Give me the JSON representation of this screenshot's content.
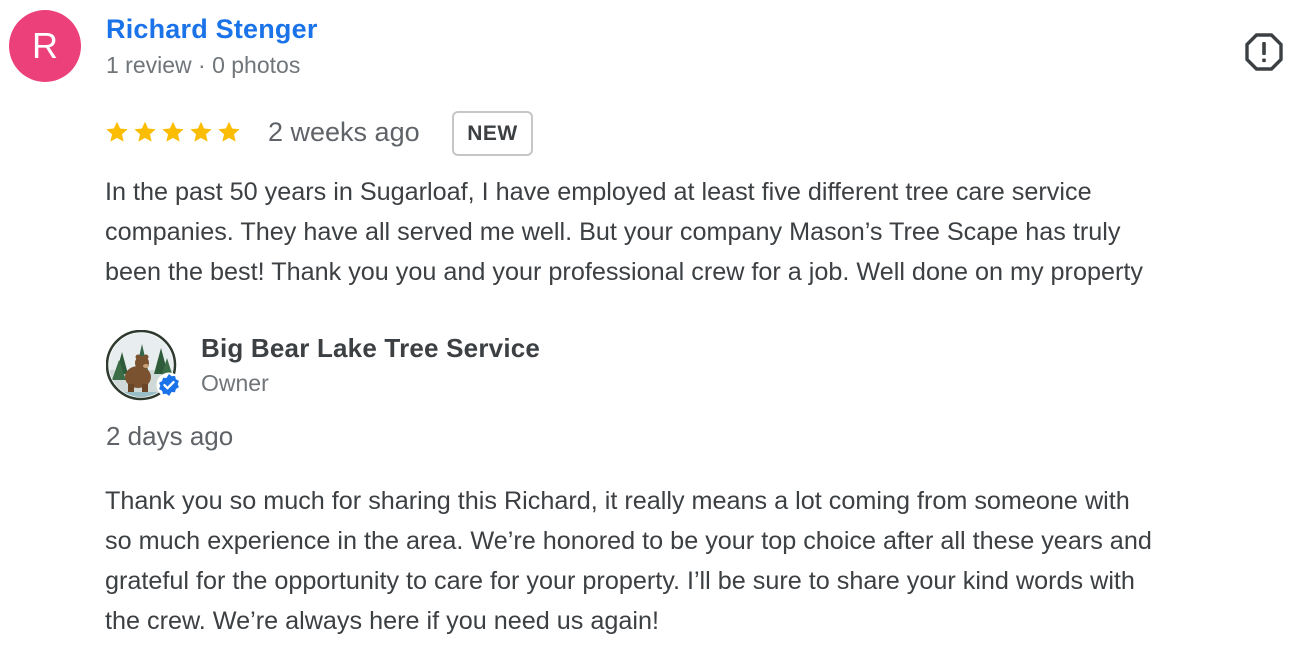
{
  "review": {
    "reviewer": {
      "initial": "R",
      "name": "Richard Stenger",
      "meta": "1 review · 0 photos",
      "avatar_color": "#ec407a"
    },
    "rating": 5,
    "time_ago": "2 weeks ago",
    "badge": "NEW",
    "text_lines": [
      "In the past 50 years in Sugarloaf, I have employed at least five different tree care service",
      "companies. They have all served me well. But your company Mason’s Tree Scape has truly",
      "been the best! Thank you you and your professional crew for a job. Well done on my property"
    ],
    "report_icon": "report-flag-icon"
  },
  "owner_reply": {
    "business_name": "Big Bear Lake Tree Service",
    "role": "Owner",
    "verified_icon": "verified-check-icon",
    "time_ago": "2 days ago",
    "text_lines": [
      "Thank you so much for sharing this Richard, it really means a lot coming from someone with",
      "so much experience in the area. We’re honored to be your top choice after all these years and",
      "grateful for the opportunity to care for your property. I’ll be sure to share your kind words with",
      "the crew. We’re always here if you need us again!"
    ]
  },
  "colors": {
    "accent_link": "#1a73e8",
    "star": "#fbbc04",
    "verified": "#1a73e8",
    "text": "#3c4043",
    "muted": "#70757a"
  }
}
